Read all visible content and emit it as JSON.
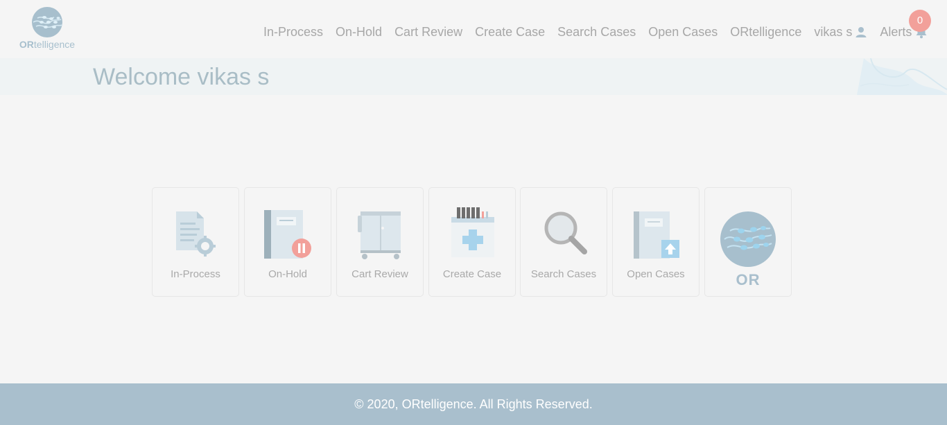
{
  "header": {
    "logo": {
      "brand_bold": "OR",
      "brand_rest": "telligence"
    },
    "nav": [
      {
        "label": "In-Process"
      },
      {
        "label": "On-Hold"
      },
      {
        "label": "Cart Review"
      },
      {
        "label": "Create Case"
      },
      {
        "label": "Search Cases"
      },
      {
        "label": "Open Cases"
      },
      {
        "label": "ORtelligence"
      },
      {
        "label": "vikas s",
        "icon": "user-icon"
      },
      {
        "label": "Alerts",
        "icon": "bell-icon"
      }
    ],
    "alerts_count": "0"
  },
  "welcome": {
    "title": "Welcome vikas s"
  },
  "tiles": [
    {
      "label": "In-Process",
      "icon": "document-gear-icon"
    },
    {
      "label": "On-Hold",
      "icon": "notebook-pause-icon"
    },
    {
      "label": "Cart Review",
      "icon": "cart-cabinet-icon"
    },
    {
      "label": "Create Case",
      "icon": "case-plus-icon"
    },
    {
      "label": "Search Cases",
      "icon": "magnifier-icon"
    },
    {
      "label": "Open Cases",
      "icon": "notebook-upload-icon"
    },
    {
      "label": "OR",
      "icon": "ortelligence-logo-icon"
    }
  ],
  "footer": {
    "text": "© 2020, ORtelligence. All Rights Reserved."
  },
  "colors": {
    "accent": "#a9bfcd",
    "badge": "#f2a09a",
    "background": "#f5f5f5",
    "welcome_band": "#eff3f4"
  }
}
